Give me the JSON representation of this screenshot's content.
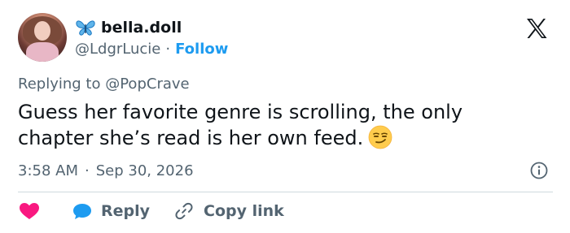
{
  "author": {
    "display_name": "bella.doll",
    "handle": "@LdgrLucie",
    "separator": "·",
    "follow_label": "Follow"
  },
  "reply_context": {
    "prefix": "Replying to",
    "handle": "@PopCrave"
  },
  "tweet": {
    "text": "Guess her favorite genre is scrolling, the only chapter she’s read is her own feed."
  },
  "meta": {
    "time": "3:58 AM",
    "separator": "·",
    "date": "Sep 30, 2026"
  },
  "actions": {
    "reply_label": "Reply",
    "copy_link_label": "Copy link"
  },
  "icons": {
    "brand": "x-logo-icon",
    "verified_emoji": "butterfly-icon",
    "like": "heart-icon",
    "reply": "reply-bubble-icon",
    "copy": "link-icon",
    "info": "info-icon",
    "emoji": "smirk-emoji"
  },
  "colors": {
    "text": "#0f1419",
    "secondary": "#536471",
    "accent": "#1d9bf0",
    "heart": "#f91880",
    "divider": "#cfd9de"
  }
}
